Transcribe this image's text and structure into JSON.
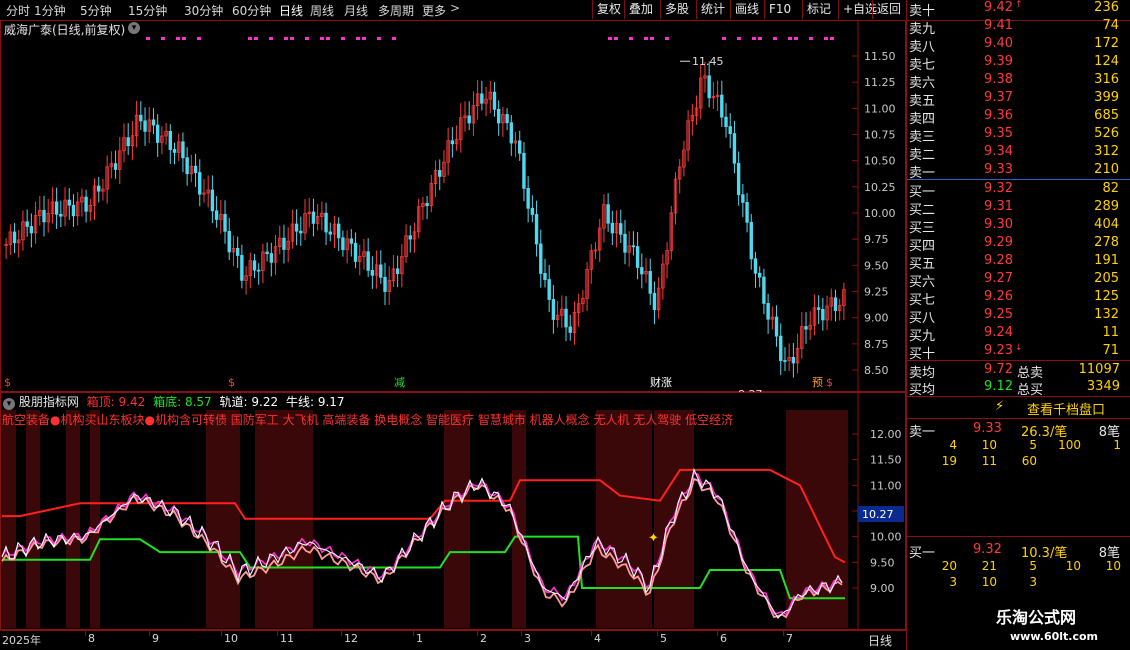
{
  "toolbar": {
    "timeframes": [
      "分时",
      "1分钟",
      "5分钟",
      "15分钟",
      "30分钟",
      "60分钟",
      "日线",
      "周线",
      "月线",
      "多周期",
      "更多"
    ],
    "buttons": [
      "复权",
      "叠加",
      "多股",
      "统计",
      "画线",
      "F10",
      "标记",
      "+自选",
      "返回"
    ]
  },
  "chart": {
    "title": "威海广泰(日线,前复权)",
    "high_label": "11.45",
    "low_label": "8.27",
    "price_axis": [
      "11.50",
      "11.25",
      "11.00",
      "10.75",
      "10.50",
      "10.25",
      "10.00",
      "9.75",
      "9.50",
      "9.25",
      "9.00",
      "8.75",
      "8.50"
    ],
    "markers": [
      {
        "text": "$",
        "color": "#ff3a3a"
      },
      {
        "text": "$",
        "color": "#ff3a3a"
      },
      {
        "text": "减",
        "color": "#22e022"
      },
      {
        "text": "财涨",
        "color": "#ffffff"
      },
      {
        "text": "预",
        "color": "#ffa020"
      },
      {
        "text": "$",
        "color": "#ff3a3a"
      }
    ]
  },
  "indicator": {
    "name": "股朋指标网",
    "box_top_label": "箱顶:",
    "box_top_value": "9.42",
    "box_bottom_label": "箱底:",
    "box_bottom_value": "8.57",
    "track_label": "轨道:",
    "track_value": "9.22",
    "bull_label": "牛线:",
    "bull_value": "9.17",
    "concepts": "航空装备●机构买山东板块●机构含可转债 国防军工 大飞机 高端装备 换电概念 智能医疗 智慧城市 机器人概念 无人机 无人驾驶 低空经济",
    "axis": [
      "12.00",
      "11.50",
      "11.00",
      "10.50",
      "10.00",
      "9.50",
      "9.00"
    ],
    "cursor_value": "10.27"
  },
  "time_axis": {
    "labels": [
      "2025年",
      "8",
      "9",
      "10",
      "11",
      "12",
      "1",
      "2",
      "3",
      "4",
      "5",
      "6",
      "7"
    ],
    "period": "日线"
  },
  "order_book": {
    "asks": [
      {
        "label": "卖十",
        "price": "9.42",
        "vol": "236",
        "flag": "↑"
      },
      {
        "label": "卖九",
        "price": "9.41",
        "vol": "74"
      },
      {
        "label": "卖八",
        "price": "9.40",
        "vol": "172"
      },
      {
        "label": "卖七",
        "price": "9.39",
        "vol": "124"
      },
      {
        "label": "卖六",
        "price": "9.38",
        "vol": "316"
      },
      {
        "label": "卖五",
        "price": "9.37",
        "vol": "399"
      },
      {
        "label": "卖四",
        "price": "9.36",
        "vol": "685"
      },
      {
        "label": "卖三",
        "price": "9.35",
        "vol": "526"
      },
      {
        "label": "卖二",
        "price": "9.34",
        "vol": "312"
      },
      {
        "label": "卖一",
        "price": "9.33",
        "vol": "210"
      }
    ],
    "bids": [
      {
        "label": "买一",
        "price": "9.32",
        "vol": "82"
      },
      {
        "label": "买二",
        "price": "9.31",
        "vol": "289"
      },
      {
        "label": "买三",
        "price": "9.30",
        "vol": "404"
      },
      {
        "label": "买四",
        "price": "9.29",
        "vol": "278"
      },
      {
        "label": "买五",
        "price": "9.28",
        "vol": "191"
      },
      {
        "label": "买六",
        "price": "9.27",
        "vol": "205"
      },
      {
        "label": "买七",
        "price": "9.26",
        "vol": "125"
      },
      {
        "label": "买八",
        "price": "9.25",
        "vol": "132"
      },
      {
        "label": "买九",
        "price": "9.24",
        "vol": "11"
      },
      {
        "label": "买十",
        "price": "9.23",
        "vol": "71",
        "flag": "↓"
      }
    ],
    "summary": [
      {
        "label": "卖均",
        "price": "9.72",
        "name": "总卖",
        "vol": "11097"
      },
      {
        "label": "买均",
        "price": "9.12",
        "name": "总买",
        "vol": "3349"
      }
    ],
    "view_depth": "查看千档盘口",
    "sell1_detail": {
      "label": "卖一",
      "price": "9.33",
      "avg": "26.3/笔",
      "count": "8笔",
      "row1": [
        "4",
        "10",
        "5",
        "100",
        "1"
      ],
      "row2": [
        "19",
        "11",
        "60"
      ]
    },
    "buy1_detail": {
      "label": "买一",
      "price": "9.32",
      "avg": "10.3/笔",
      "count": "8笔",
      "row1": [
        "20",
        "21",
        "5",
        "10",
        "10"
      ],
      "row2": [
        "3",
        "10",
        "3"
      ]
    }
  },
  "watermark": {
    "name": "乐淘公式网",
    "url": "www.60lt.com"
  },
  "colors": {
    "up": "#ff3a3a",
    "down": "#4fd8f0",
    "frame": "#8a1010",
    "box_top": "#ff2020",
    "box_bottom": "#22e022",
    "bull": "#ff9a9a",
    "track": "#ff30d0",
    "price": "#ffffff",
    "band": "#3a0808"
  }
}
